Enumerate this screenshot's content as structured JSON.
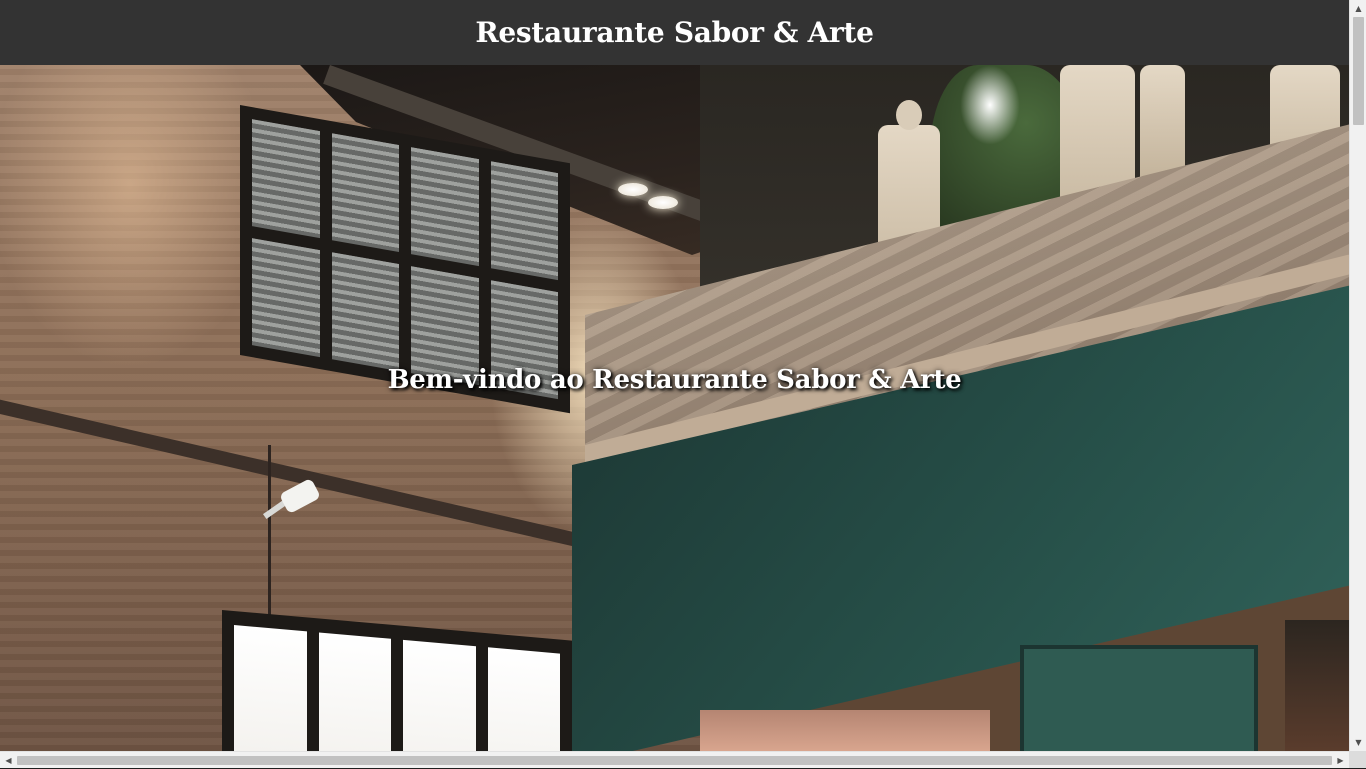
{
  "header": {
    "title": "Restaurante Sabor & Arte"
  },
  "hero": {
    "tagline": "Bem-vindo ao Restaurante Sabor & Arte",
    "image_icon": "restaurant-interior-photo"
  },
  "colors": {
    "header_bg": "#333333",
    "header_text": "#ffffff",
    "tagline_text": "#ffffff"
  },
  "scrollbars": {
    "up_arrow": "▲",
    "down_arrow": "▼",
    "left_arrow": "◀",
    "right_arrow": "▶"
  }
}
